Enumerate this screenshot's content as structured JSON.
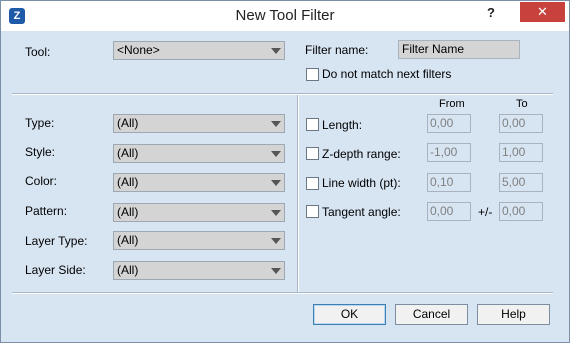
{
  "window": {
    "title": "New Tool Filter",
    "help_label": "?",
    "close_label": "✕",
    "app_icon_label": "Z"
  },
  "top": {
    "tool_label": "Tool:",
    "tool_value": "<None>",
    "filter_name_label": "Filter name:",
    "filter_name_value": "Filter Name",
    "dont_match_label": "Do not match next filters"
  },
  "left": {
    "type_label": "Type:",
    "type_value": "(All)",
    "style_label": "Style:",
    "style_value": "(All)",
    "color_label": "Color:",
    "color_value": "(All)",
    "pattern_label": "Pattern:",
    "pattern_value": "(All)",
    "layer_type_label": "Layer Type:",
    "layer_type_value": "(All)",
    "layer_side_label": "Layer Side:",
    "layer_side_value": "(All)"
  },
  "right": {
    "from_header": "From",
    "to_header": "To",
    "length_label": "Length:",
    "length_from": "0,00",
    "length_to": "0,00",
    "zdepth_label": "Z-depth range:",
    "zdepth_from": "-1,00",
    "zdepth_to": "1,00",
    "linewidth_label": "Line width (pt):",
    "linewidth_from": "0,10",
    "linewidth_to": "5,00",
    "tangent_label": "Tangent angle:",
    "tangent_from": "0,00",
    "tangent_sep": "+/-",
    "tangent_to": "0,00"
  },
  "buttons": {
    "ok_label": "OK",
    "cancel_label": "Cancel",
    "help_label": "Help"
  }
}
